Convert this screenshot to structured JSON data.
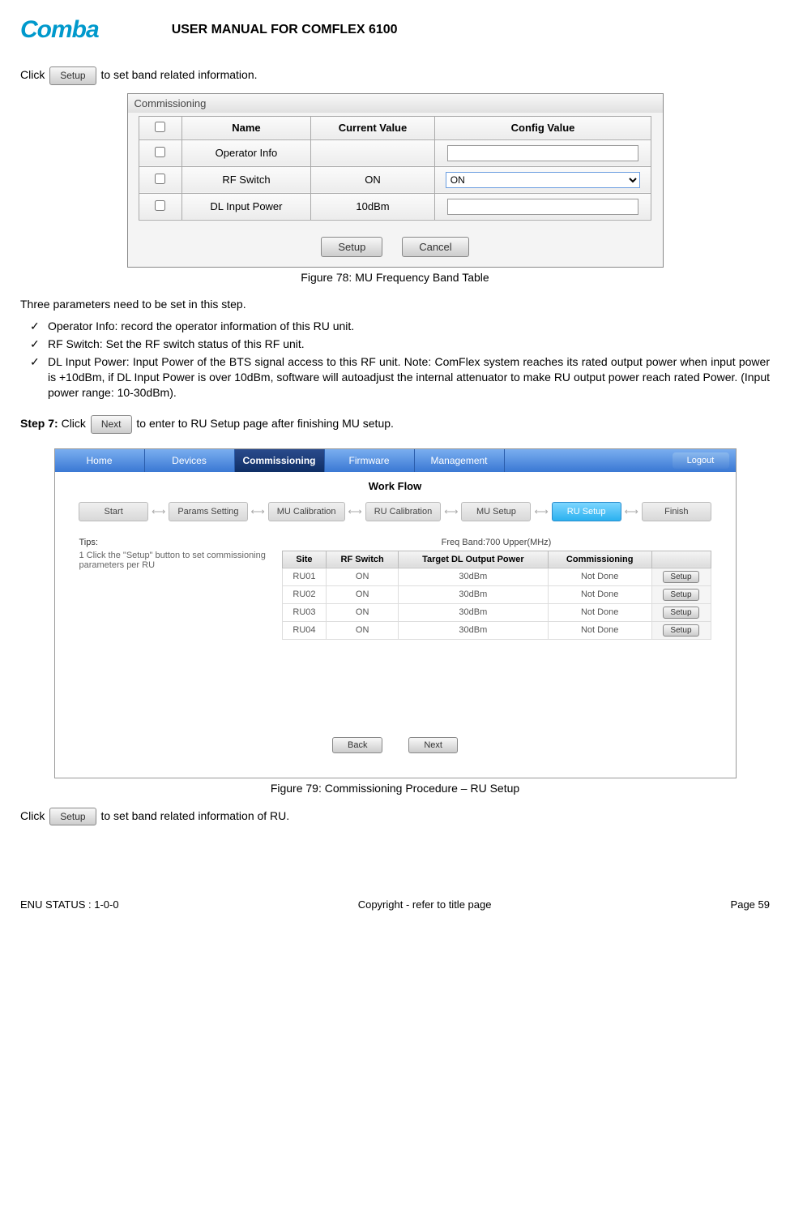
{
  "header": {
    "logo": "Comba",
    "title": "USER MANUAL FOR COMFLEX 6100"
  },
  "intro": {
    "prefix": "Click ",
    "btn": "Setup",
    "suffix": "to set band related information."
  },
  "panel1": {
    "title": "Commissioning",
    "headers": [
      "",
      "Name",
      "Current Value",
      "Config Value"
    ],
    "rows": [
      {
        "name": "Operator Info",
        "current": "",
        "config_type": "text",
        "config": ""
      },
      {
        "name": "RF Switch",
        "current": "ON",
        "config_type": "select",
        "config": "ON"
      },
      {
        "name": "DL Input Power",
        "current": "10dBm",
        "config_type": "text",
        "config": ""
      }
    ],
    "btn_setup": "Setup",
    "btn_cancel": "Cancel"
  },
  "fig78": "Figure 78: MU Frequency Band Table",
  "para_three": "Three parameters need to be set in this step.",
  "bullets": [
    "Operator Info: record the operator information of this RU unit.",
    "RF Switch: Set the RF switch status of this RF unit.",
    "DL Input Power: Input Power of the BTS signal access to this RF unit. Note: ComFlex system reaches its rated output power when input power is +10dBm, if DL Input Power is over 10dBm, software will autoadjust the internal attenuator to make RU output power reach rated Power. (Input power range: 10-30dBm)."
  ],
  "step7": {
    "label": "Step 7:",
    "click": " Click ",
    "btn": "Next",
    "suffix": " to enter to RU Setup page after finishing MU setup."
  },
  "app": {
    "nav": [
      "Home",
      "Devices",
      "Commissioning",
      "Firmware",
      "Management"
    ],
    "nav_active": 2,
    "logout": "Logout",
    "wf_title": "Work Flow",
    "wf_steps": [
      "Start",
      "Params Setting",
      "MU Calibration",
      "RU Calibration",
      "MU Setup",
      "RU Setup",
      "Finish"
    ],
    "wf_active": 5,
    "tips_head": "Tips:",
    "tips_body": "1 Click the \"Setup\" button to set commissioning parameters per RU",
    "freq_label": "Freq Band:700 Upper(MHz)",
    "ru_headers": [
      "Site",
      "RF Switch",
      "Target DL Output Power",
      "Commissioning",
      ""
    ],
    "ru_rows": [
      {
        "site": "RU01",
        "rf": "ON",
        "target": "30dBm",
        "comm": "Not Done",
        "btn": "Setup"
      },
      {
        "site": "RU02",
        "rf": "ON",
        "target": "30dBm",
        "comm": "Not Done",
        "btn": "Setup"
      },
      {
        "site": "RU03",
        "rf": "ON",
        "target": "30dBm",
        "comm": "Not Done",
        "btn": "Setup"
      },
      {
        "site": "RU04",
        "rf": "ON",
        "target": "30dBm",
        "comm": "Not Done",
        "btn": "Setup"
      }
    ],
    "btn_back": "Back",
    "btn_next": "Next"
  },
  "fig79": "Figure 79: Commissioning Procedure – RU Setup",
  "outro": {
    "prefix": "Click ",
    "btn": "Setup",
    "suffix": " to set band related information of RU."
  },
  "footer": {
    "left": "ENU STATUS : 1-0-0",
    "center": "Copyright - refer to title page",
    "right": "Page 59"
  }
}
